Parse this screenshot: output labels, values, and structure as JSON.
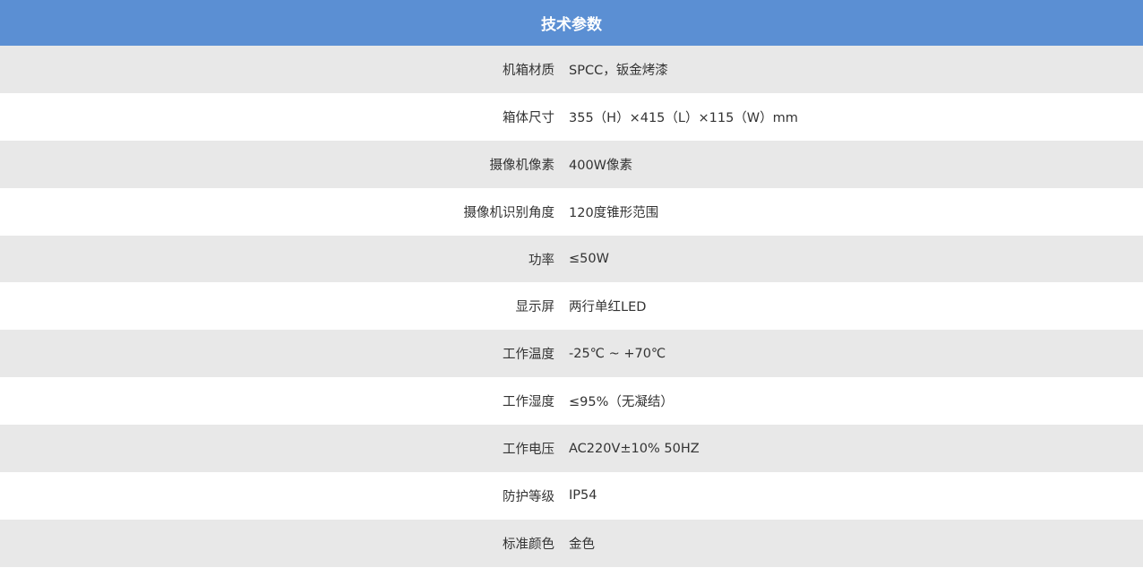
{
  "table": {
    "title": "技术参数",
    "rows": [
      {
        "label": "机箱材质",
        "value": "SPCC，钣金烤漆"
      },
      {
        "label": "箱体尺寸",
        "value": "355（H）×415（L）×115（W）mm"
      },
      {
        "label": "摄像机像素",
        "value": "400W像素"
      },
      {
        "label": "摄像机识别角度",
        "value": "120度锥形范围"
      },
      {
        "label": "功率",
        "value": "≤50W"
      },
      {
        "label": "显示屏",
        "value": "两行单红LED"
      },
      {
        "label": "工作温度",
        "value": "-25℃ ~ +70℃"
      },
      {
        "label": "工作湿度",
        "value": "≤95%（无凝结）"
      },
      {
        "label": "工作电压",
        "value": "AC220V±10% 50HZ"
      },
      {
        "label": "防护等级",
        "value": "IP54"
      },
      {
        "label": "标准颜色",
        "value": "金色"
      }
    ]
  }
}
